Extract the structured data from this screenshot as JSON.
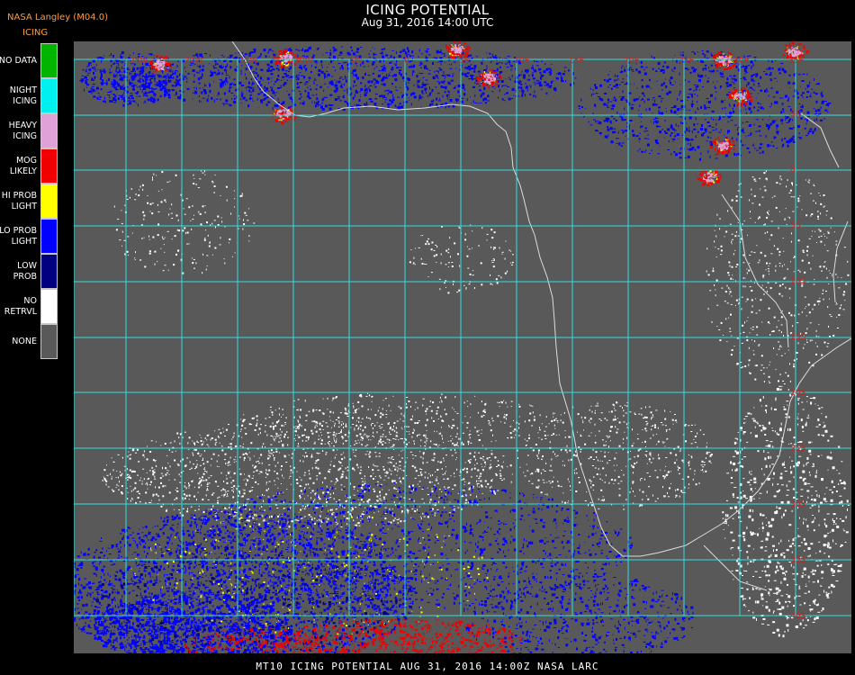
{
  "header": {
    "title": "ICING POTENTIAL",
    "subtitle": "Aug 31, 2016 14:00 UTC",
    "provider": "NASA Langley (M04.0)",
    "product": "ICING"
  },
  "legend": {
    "items": [
      {
        "line1": "NO DATA",
        "line2": "",
        "color": "#00b400"
      },
      {
        "line1": "NIGHT",
        "line2": "ICING",
        "color": "#00f0f0"
      },
      {
        "line1": "HEAVY",
        "line2": "ICING",
        "color": "#e0a0d8"
      },
      {
        "line1": "MOG",
        "line2": "LIKELY",
        "color": "#f00000"
      },
      {
        "line1": "HI PROB",
        "line2": "LIGHT",
        "color": "#ffff00"
      },
      {
        "line1": "LO PROB",
        "line2": "LIGHT",
        "color": "#0000ff"
      },
      {
        "line1": "LOW",
        "line2": "PROB",
        "color": "#000080"
      },
      {
        "line1": "NO",
        "line2": "RETRVL",
        "color": "#ffffff"
      },
      {
        "line1": "NONE",
        "line2": "",
        "color": "#595959"
      }
    ]
  },
  "map": {
    "background_color": "#595959",
    "grid_color": "#2fe0e0",
    "coast_color": "#dcdcdc",
    "lon_labels": [
      "25W",
      "20W",
      "15W",
      "10W",
      "5W",
      "0",
      "5E",
      "10E",
      "15E",
      "20E",
      "25E",
      "30E",
      "35E"
    ],
    "lat_labels": [
      "5N",
      "0",
      "5S",
      "10S",
      "15S",
      "20S",
      "25S",
      "30S",
      "35S",
      "40S"
    ],
    "label_color": "#d02020"
  },
  "footer": {
    "text": "MT10  ICING POTENTIAL   AUG 31, 2016 14:00Z   NASA LARC"
  }
}
